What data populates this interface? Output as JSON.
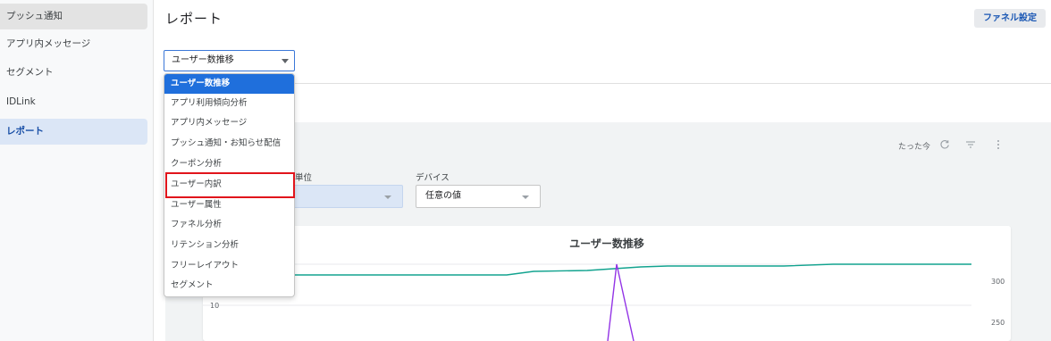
{
  "sidebar": {
    "items": [
      {
        "label": "プッシュ通知"
      },
      {
        "label": "アプリ内メッセージ"
      },
      {
        "label": "セグメント"
      },
      {
        "label": "IDLink"
      },
      {
        "label": "レポート"
      }
    ]
  },
  "header": {
    "title": "レポート",
    "funnel_button": "ファネル設定"
  },
  "report_select": {
    "value": "ユーザー数推移",
    "options": [
      "ユーザー数推移",
      "アプリ利用傾向分析",
      "アプリ内メッセージ",
      "プッシュ通知・お知らせ配信",
      "クーポン分析",
      "ユーザー内訳",
      "ユーザー属性",
      "ファネル分析",
      "リテンション分析",
      "フリーレイアウト",
      "セグメント"
    ],
    "highlighted_option": "ユーザー内訳"
  },
  "toolbar": {
    "time_text": "たった今",
    "refresh_icon": "refresh-icon",
    "filter_icon": "filter-icon",
    "more_icon": "more-vert-icon"
  },
  "filters": {
    "unit_label": "単位",
    "device_label": "デバイス",
    "device_value": "任意の値"
  },
  "chart_data": {
    "type": "line",
    "title": "ユーザー数推移",
    "left_axis_ticks": [
      "10"
    ],
    "right_axis_ticks": [
      "300",
      "250"
    ],
    "series": [
      {
        "color": "#12a38f"
      },
      {
        "color": "#9334e6"
      }
    ]
  },
  "colors": {
    "accent": "#1f6fdc",
    "highlight": "#e1141b",
    "teal": "#12a38f",
    "purple": "#9334e6"
  }
}
